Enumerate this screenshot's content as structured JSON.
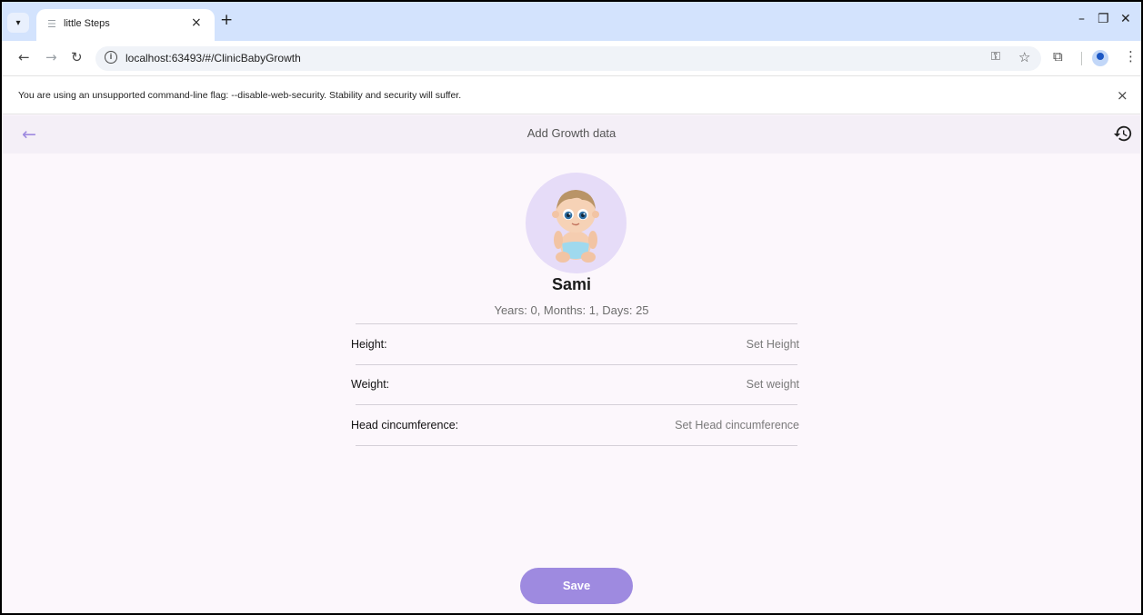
{
  "browser": {
    "tab_title": "little Steps",
    "url": "localhost:63493/#/ClinicBabyGrowth",
    "warning": "You are using an unsupported command-line flag: --disable-web-security. Stability and security will suffer."
  },
  "appbar": {
    "title": "Add Growth data"
  },
  "baby": {
    "name": "Sami",
    "age": "Years: 0, Months: 1, Days: 25"
  },
  "fields": [
    {
      "label": "Height:",
      "value": "Set Height"
    },
    {
      "label": "Weight:",
      "value": "Set weight"
    },
    {
      "label": "Head cincumference:",
      "value": "Set Head cincumference"
    }
  ],
  "actions": {
    "save_label": "Save"
  },
  "colors": {
    "accent": "#9e8ae0",
    "background": "#fcf7fc",
    "appbar": "#f4eff7"
  }
}
